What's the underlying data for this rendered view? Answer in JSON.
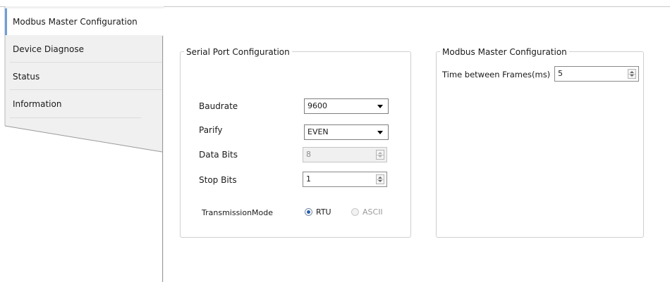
{
  "nav": {
    "tabs": [
      {
        "label": "Modbus Master Configuration",
        "active": true
      },
      {
        "label": "Device Diagnose",
        "active": false
      },
      {
        "label": "Status",
        "active": false
      },
      {
        "label": "Information",
        "active": false
      }
    ]
  },
  "serial": {
    "title": "Serial Port Configuration",
    "baudrate_label": "Baudrate",
    "baudrate_value": "9600",
    "parity_label": "Parify",
    "parity_value": "EVEN",
    "databits_label": "Data Bits",
    "databits_value": "8",
    "stopbits_label": "Stop Bits",
    "stopbits_value": "1",
    "mode_label": "TransmissionMode",
    "mode_rtu": "RTU",
    "mode_ascii": "ASCII"
  },
  "master": {
    "title": "Modbus Master Configuration",
    "time_label": "Time between Frames(ms)",
    "time_value": "5"
  },
  "colors": {
    "nav_background": "#f0f0f0",
    "active_accent": "#6da0d8"
  }
}
